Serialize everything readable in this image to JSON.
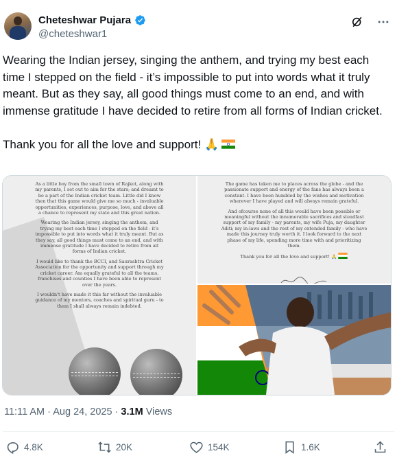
{
  "author": {
    "display_name": "Cheteshwar Pujara",
    "handle": "@cheteshwar1",
    "verified_color": "#1d9bf0"
  },
  "header_icons": [
    "grok-icon",
    "more-icon"
  ],
  "tweet": {
    "paragraph1": "Wearing the Indian jersey, singing the anthem, and trying my best each time I stepped on the field - it’s impossible to put into words what it truly meant. But as they say, all good things must come to an end, and with immense gratitude I have decided to retire from all forms of Indian cricket.",
    "paragraph2": "Thank you for all the love and support!",
    "emoji": "🙏"
  },
  "letter_left": {
    "paragraphs": [
      "As a little boy from the small town of Rajkot, along with my parents, I set out to aim for the stars; and dreamt to be a part of the Indian cricket team. Little did I know then that this game would give me so much - invaluable opportunities, experiences, purpose, love, and above all a chance to represent my state and this great nation.",
      "Wearing the Indian jersey, singing the anthem, and trying my best each time I stepped on the field - it's impossible to put into words what it truly meant. But as they say, all good things must come to an end, and with immense gratitude I have decided to retire from all forms of Indian cricket.",
      "I would like to thank the BCCI, and Saurashtra Cricket Association for the opportunity and support through my cricket career. Am equally grateful to all the teams, franchises and counties I have been able to represent over the years.",
      "I wouldn't have made it this far without the invaluable guidance of my mentors, coaches and spiritual guru - to them I shall always remain indebted."
    ]
  },
  "letter_right": {
    "paragraphs": [
      "The game has taken me to places across the globe - and the passionate support and energy of the fans has always been a constant. I have been humbled by the wishes and motivation wherever I have played and will always remain grateful.",
      "And ofcourse none of all this would have been possible or meaningful without the innumerable sacrifices and steadfast support of my family - my parents, my wife Puja, my daughter Aditi; my in-laws and the rest of my extended family - who have made this journey truly worth it. I look forward to the next phase of my life, spending more time with and prioritizing them.",
      "Thank you for all the love and support! 🙏"
    ]
  },
  "meta": {
    "time": "11:11 AM",
    "separator": "·",
    "date": "Aug 24, 2025",
    "views_count": "3.1M",
    "views_label": "Views"
  },
  "actions": {
    "replies": "4.8K",
    "reposts": "20K",
    "likes": "154K",
    "bookmarks": "1.6K"
  },
  "colors": {
    "text": "#0f1419",
    "secondary": "#536471",
    "border": "#cfd9de",
    "saffron": "#ff9933",
    "india_green": "#138808"
  }
}
